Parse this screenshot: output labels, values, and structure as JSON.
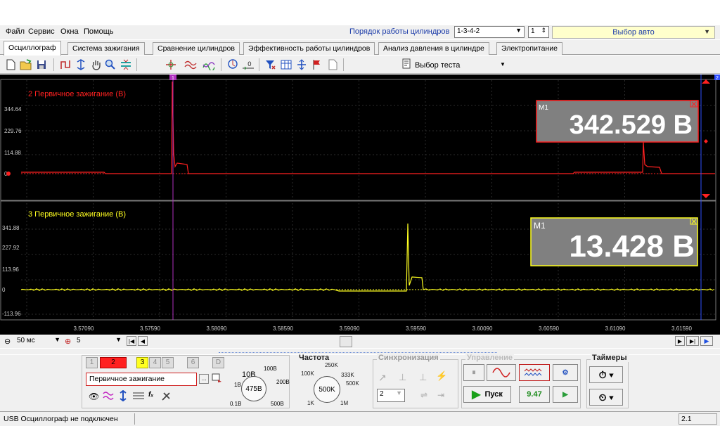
{
  "menu": {
    "file": "Файл",
    "service": "Сервис",
    "windows": "Окна",
    "help": "Помощь"
  },
  "header": {
    "order_label": "Порядок работы цилиндров",
    "order_value": "1-3-4-2",
    "cylinder_value": "1",
    "auto_select": "Выбор авто"
  },
  "tabs": [
    {
      "label": "Осциллограф",
      "active": true
    },
    {
      "label": "Система зажигания"
    },
    {
      "label": "Сравнение цилиндров"
    },
    {
      "label": "Эффективность работы цилиндров"
    },
    {
      "label": "Анализ давления в цилиндре"
    },
    {
      "label": "Электропитание"
    }
  ],
  "toolbar": {
    "test_select": "Выбор теста"
  },
  "channels": [
    {
      "name": "2 Первичное зажигание (В)",
      "color": "#ff2020",
      "ticks": [
        "344.64",
        "229.76",
        "114.88",
        "0"
      ],
      "marker_label": "М1",
      "marker_value": "342.529 В"
    },
    {
      "name": "3 Первичное зажигание (В)",
      "color": "#ffff20",
      "ticks": [
        "341.88",
        "227.92",
        "113.96",
        "0",
        "-113.96"
      ],
      "marker_label": "М1",
      "marker_value": "13.428 В"
    }
  ],
  "time_ticks": [
    "3.57090",
    "3.57590",
    "3.58090",
    "3.58590",
    "3.59090",
    "3.59590",
    "3.60090",
    "3.60590",
    "3.61090",
    "3.61590"
  ],
  "cursor_labels": {
    "left": "1",
    "right": "2"
  },
  "timebar": {
    "timebase": "50 мс",
    "zoom": "5"
  },
  "controls": {
    "cylinders": [
      "1",
      "2",
      "3",
      "4",
      "5",
      "6",
      "D"
    ],
    "signal_type": "Первичное зажигание",
    "freq_title": "Частота",
    "sync_title": "Синхронизация",
    "control_title": "Управление",
    "timers_title": "Таймеры",
    "amp_knob": {
      "value": "475В",
      "labels": [
        "10В",
        "100В",
        "1В",
        "200В",
        "0.1В",
        "500В"
      ]
    },
    "freq_knob": {
      "value": "500K",
      "labels": [
        "100K",
        "250K",
        "333K",
        "500K",
        "1K",
        "1M"
      ]
    },
    "sync_value": "2",
    "start_label": "Пуск",
    "rate_value": "9.47"
  },
  "status": {
    "text": "USB Осциллограф не подключен",
    "version": "2.1"
  }
}
